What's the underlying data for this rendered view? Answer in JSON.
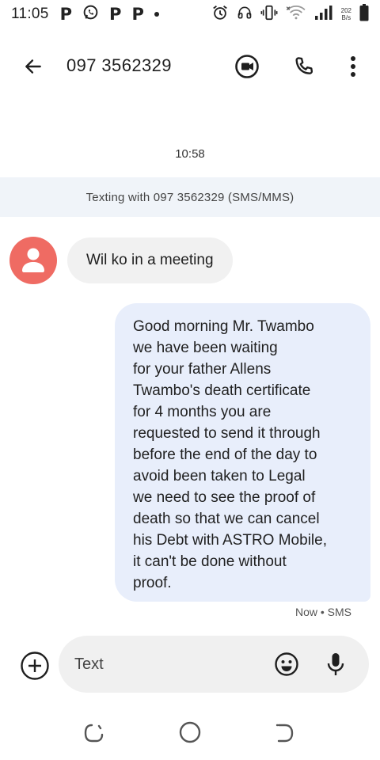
{
  "status_bar": {
    "time": "11:05",
    "net_speed_value": "202",
    "net_speed_unit": "B/s",
    "notification_icons": [
      "p-icon",
      "whatsapp-icon",
      "p-icon",
      "p-icon",
      "dot-icon"
    ],
    "system_icons": [
      "alarm-icon",
      "headset-icon",
      "vibrate-icon",
      "wifi-icon",
      "signal-icon",
      "battery-icon"
    ]
  },
  "app_bar": {
    "title": "097 3562329",
    "actions": [
      "video-call-icon",
      "phone-icon",
      "more-vert-icon"
    ]
  },
  "conversation": {
    "timestamp": "10:58",
    "banner": "Texting with 097 3562329 (SMS/MMS)",
    "incoming": {
      "text": "Wil ko in a meeting"
    },
    "outgoing": {
      "text": "Good morning Mr. Twambo\nwe have been waiting\nfor your father Allens\nTwambo's  death certificate\nfor 4 months you are\nrequested to send it through\nbefore the end of the day to\navoid been taken to Legal\nwe need to see the proof of\ndeath so that we can cancel\nhis Debt with ASTRO Mobile,\nit can't be done without\nproof.",
      "status": "Now • SMS"
    }
  },
  "compose": {
    "placeholder": "Text"
  },
  "colors": {
    "avatar": "#ef6b63",
    "outgoing_bubble": "#e8eefb",
    "incoming_bubble": "#f1f1f1",
    "banner": "#f0f4f9"
  }
}
